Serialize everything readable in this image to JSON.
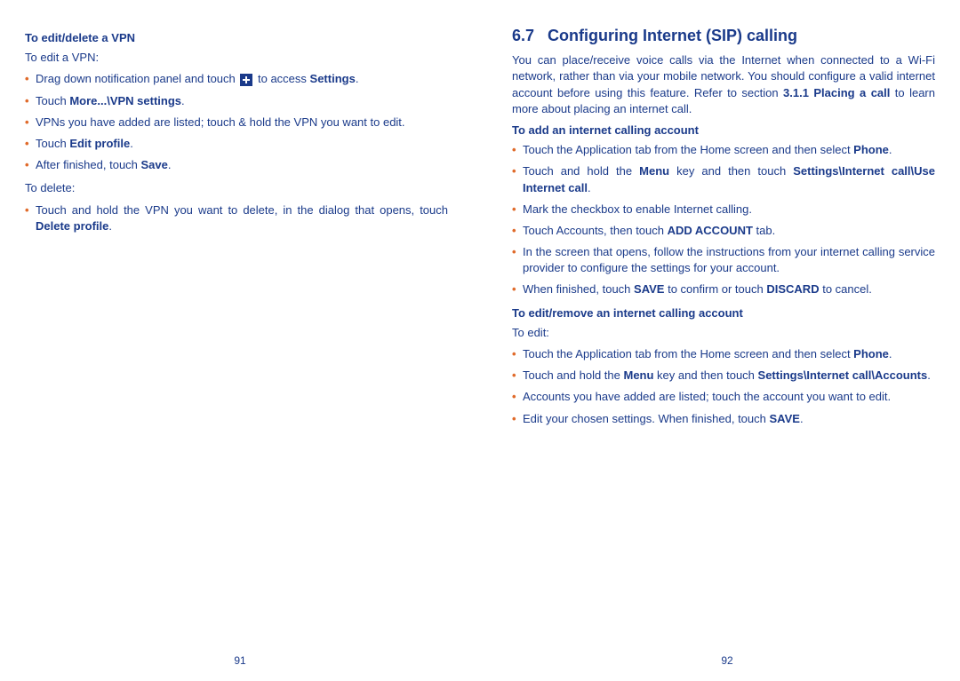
{
  "left": {
    "h_edit_delete_vpn": "To edit/delete a VPN",
    "p_editvpn": "To edit a VPN:",
    "li_1a": "Drag down notification panel and touch ",
    "li_1b": " to access ",
    "li_1c_bold": "Settings",
    "li_1d": ".",
    "li_2a": "Touch ",
    "li_2b_bold": "More...\\VPN settings",
    "li_2c": ".",
    "li_3": "VPNs you have added are listed; touch & hold the VPN you want to edit.",
    "li_4a": "Touch ",
    "li_4b_bold": "Edit profile",
    "li_4c": ".",
    "li_5a": "After finished, touch ",
    "li_5b_bold": "Save",
    "li_5c": ".",
    "p_delete": "To delete:",
    "li_6a": "Touch and hold the VPN you want to delete, in the dialog that opens, touch ",
    "li_6b_bold": "Delete profile",
    "li_6c": ".",
    "pagenum": "91"
  },
  "right": {
    "secnum": "6.7",
    "sectitle": "Configuring Internet (SIP) calling",
    "intro_a": "You can place/receive voice calls via the Internet when connected to a Wi-Fi network, rather than via your mobile network. You should configure a valid internet account before using this feature. Refer to section ",
    "intro_b_bold": "3.1.1 Placing a call",
    "intro_c": " to learn more about placing an internet call.",
    "h_add": "To add an internet calling account",
    "a1a": "Touch the Application tab from the Home screen and then select ",
    "a1b_bold": "Phone",
    "a1c": ".",
    "a2a": "Touch and hold the ",
    "a2b_bold": "Menu",
    "a2c": " key and then touch ",
    "a2d_bold": "Settings\\Internet call\\Use Internet call",
    "a2e": ".",
    "a3": "Mark the checkbox to enable Internet calling.",
    "a4a": "Touch Accounts, then touch ",
    "a4b_bold": "ADD ACCOUNT",
    "a4c": " tab.",
    "a5": "In the screen that opens, follow the instructions from your internet calling service provider to configure the settings for your account.",
    "a6a": "When finished, touch ",
    "a6b_bold": "SAVE",
    "a6c": " to confirm or touch ",
    "a6d_bold": "DISCARD",
    "a6e": " to cancel.",
    "h_editrem": "To edit/remove an internet calling account",
    "p_edit": "To edit:",
    "e1a": "Touch the Application tab from the Home screen and then select ",
    "e1b_bold": "Phone",
    "e1c": ".",
    "e2a": "Touch and hold the ",
    "e2b_bold": "Menu",
    "e2c": " key and then touch ",
    "e2d_bold": "Settings\\Internet call\\Accounts",
    "e2e": ".",
    "e3": "Accounts you have added are listed; touch the account you want to edit.",
    "e4a": "Edit your chosen settings. When finished, touch ",
    "e4b_bold": "SAVE",
    "e4c": ".",
    "pagenum": "92"
  }
}
